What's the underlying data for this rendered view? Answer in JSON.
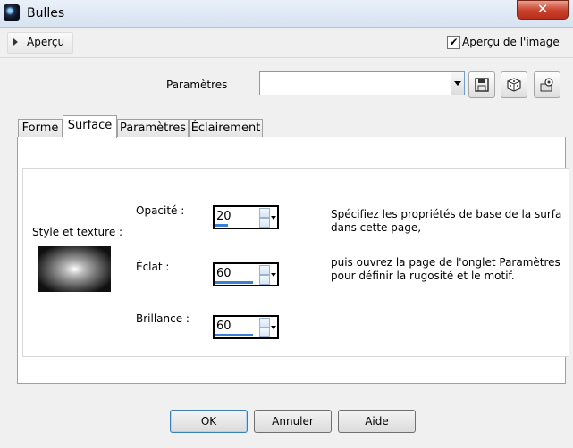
{
  "window": {
    "title": "Bulles",
    "close_label": "✕"
  },
  "preview": {
    "toggle_label": "Aperçu",
    "image_preview_label": "Aperçu de l'image",
    "image_preview_checked": true
  },
  "presets": {
    "label": "Paramètres",
    "value": ""
  },
  "tabs": [
    {
      "label": "Forme",
      "active": false
    },
    {
      "label": "Surface",
      "active": true
    },
    {
      "label": "Paramètres",
      "active": false
    },
    {
      "label": "Éclairement",
      "active": false
    }
  ],
  "surface": {
    "style_label": "Style et texture :",
    "fields": [
      {
        "label": "Opacité :",
        "value": "20",
        "fill": 0.2
      },
      {
        "label": "Éclat :",
        "value": "60",
        "fill": 0.6
      },
      {
        "label": "Brillance :",
        "value": "60",
        "fill": 0.6
      }
    ],
    "desc1_line1": "Spécifiez les propriétés de base de la surfa",
    "desc1_line2": "dans cette page,",
    "desc2_line1": "puis ouvrez la page de l'onglet Paramètres",
    "desc2_line2": "pour définir la rugosité et le motif."
  },
  "buttons": {
    "ok": "OK",
    "cancel": "Annuler",
    "help": "Aide"
  },
  "icons": {
    "app": "bubbles-app-icon",
    "save": "floppy-disk-icon",
    "random": "dice-icon",
    "manage": "preset-manager-icon"
  }
}
